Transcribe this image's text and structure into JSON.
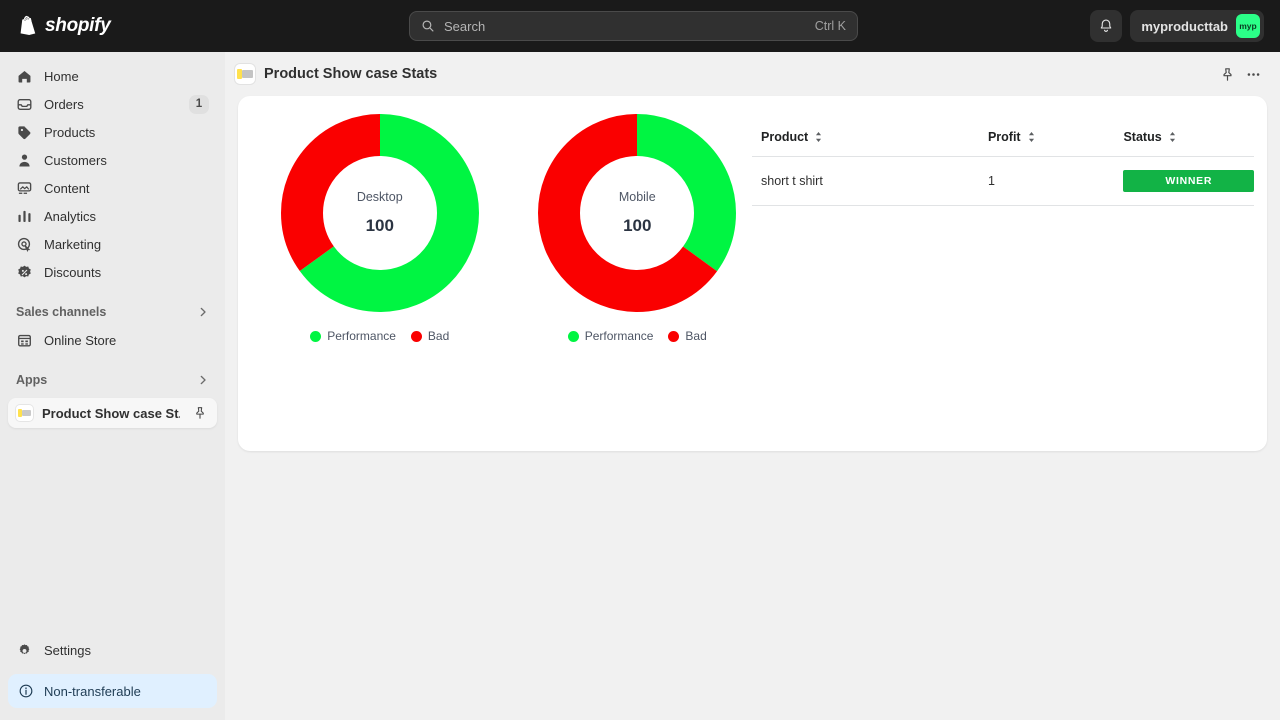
{
  "topbar": {
    "brand": "shopify",
    "search": {
      "placeholder": "Search",
      "shortcut": "Ctrl K",
      "icon": "search-icon"
    },
    "notifications_icon": "bell-icon",
    "user": {
      "name": "myproducttab",
      "initials": "myp",
      "avatar_color": "#2bff88"
    }
  },
  "sidebar": {
    "items": [
      {
        "label": "Home",
        "icon": "home-icon",
        "badge": ""
      },
      {
        "label": "Orders",
        "icon": "orders-icon",
        "badge": "1"
      },
      {
        "label": "Products",
        "icon": "products-icon",
        "badge": ""
      },
      {
        "label": "Customers",
        "icon": "customers-icon",
        "badge": ""
      },
      {
        "label": "Content",
        "icon": "content-icon",
        "badge": ""
      },
      {
        "label": "Analytics",
        "icon": "analytics-icon",
        "badge": ""
      },
      {
        "label": "Marketing",
        "icon": "marketing-icon",
        "badge": ""
      },
      {
        "label": "Discounts",
        "icon": "discounts-icon",
        "badge": ""
      }
    ],
    "sales_channels": {
      "title": "Sales channels",
      "chevron": "chevron-right-icon"
    },
    "online_store": {
      "label": "Online Store",
      "icon": "online-store-icon"
    },
    "apps": {
      "title": "Apps",
      "chevron": "chevron-right-icon"
    },
    "active_app": {
      "label": "Product Show case St...",
      "pin_icon": "pin-icon"
    },
    "settings": {
      "label": "Settings",
      "icon": "gear-icon"
    },
    "notice": {
      "label": "Non-transferable",
      "icon": "info-icon",
      "bg": "#e0f0ff"
    }
  },
  "page": {
    "title": "Product Show case Stats",
    "pin_icon": "pin-icon",
    "more_icon": "more-horizontal-icon"
  },
  "chart_data": [
    {
      "type": "pie",
      "title": "Desktop",
      "center_value": "100",
      "labels": [
        "Performance",
        "Bad"
      ],
      "values": [
        65,
        35
      ],
      "colors": [
        "#00f542",
        "#fa0000"
      ],
      "legend_position": "bottom",
      "donut": true
    },
    {
      "type": "pie",
      "title": "Mobile",
      "center_value": "100",
      "labels": [
        "Performance",
        "Bad"
      ],
      "values": [
        35,
        65
      ],
      "colors": [
        "#00f542",
        "#fa0000"
      ],
      "legend_position": "bottom",
      "donut": true
    }
  ],
  "table": {
    "columns": [
      {
        "label": "Product",
        "sortable": true
      },
      {
        "label": "Profit",
        "sortable": true
      },
      {
        "label": "Status",
        "sortable": true
      }
    ],
    "rows": [
      {
        "product": "short t shirt",
        "profit": "1",
        "status": "WINNER",
        "status_color": "#12b346"
      }
    ]
  }
}
